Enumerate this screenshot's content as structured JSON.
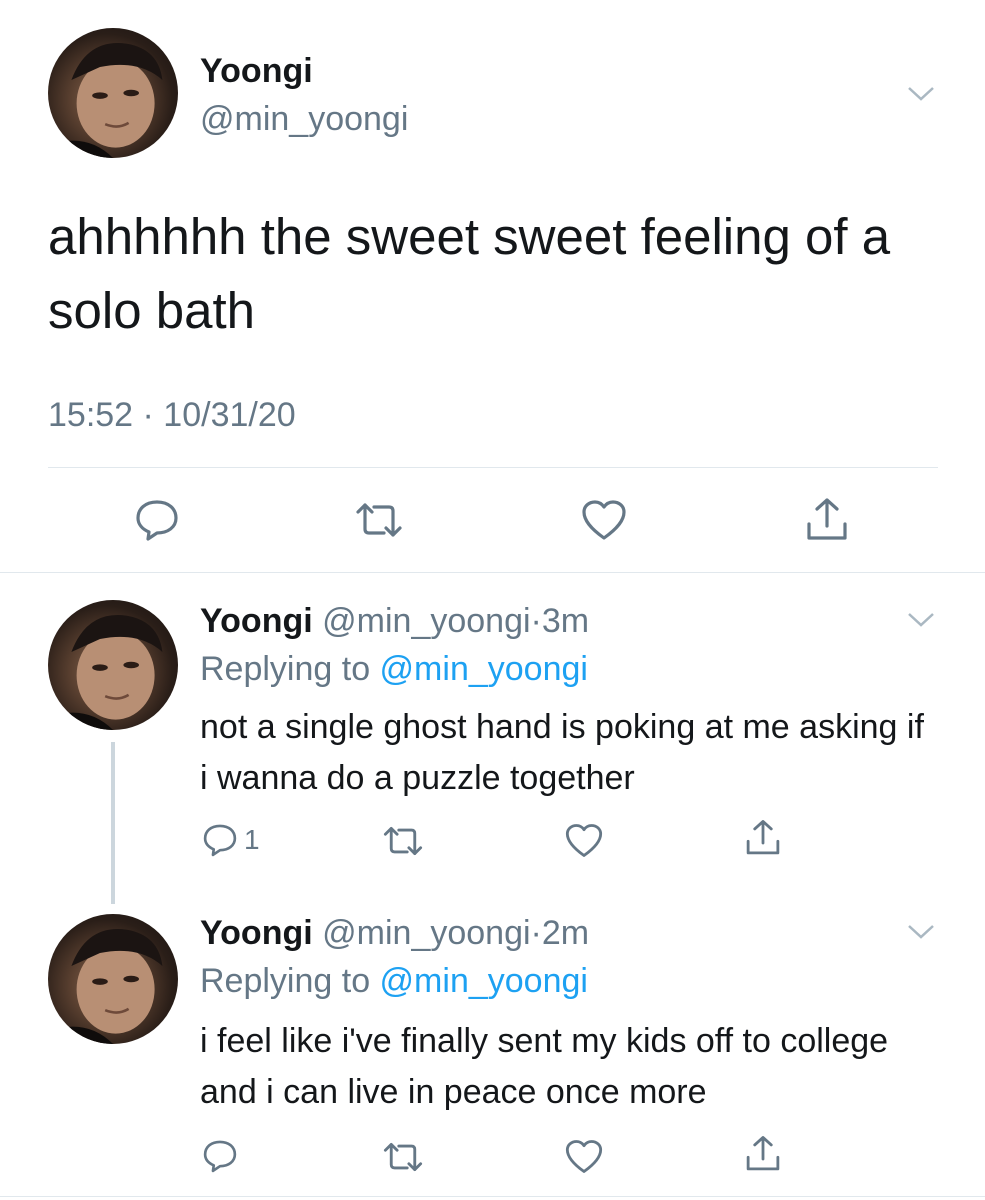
{
  "main_tweet": {
    "name": "Yoongi",
    "handle": "@min_yoongi",
    "text": "ahhhhhh the sweet sweet feeling of a solo bath",
    "timestamp": "15:52 · 10/31/20",
    "actions": [
      "reply-icon",
      "retweet-icon",
      "like-icon",
      "share-icon"
    ]
  },
  "replies": [
    {
      "name": "Yoongi",
      "handle": "@min_yoongi",
      "dot": "·",
      "time": "3m",
      "replying_prefix": "Replying to ",
      "replying_to": "@min_yoongi",
      "text": "not a single ghost hand is poking at me asking if i wanna do a puzzle together",
      "reply_count": "1"
    },
    {
      "name": "Yoongi",
      "handle": "@min_yoongi",
      "dot": "·",
      "time": "2m",
      "replying_prefix": "Replying to ",
      "replying_to": "@min_yoongi",
      "text": "i feel like i've finally sent my kids off to college and i can live in peace once more",
      "reply_count": ""
    }
  ],
  "colors": {
    "text": "#14171a",
    "secondary": "#657786",
    "link": "#1da1f2",
    "divider": "#e1e8ed",
    "thread_line": "#ccd6dd"
  }
}
